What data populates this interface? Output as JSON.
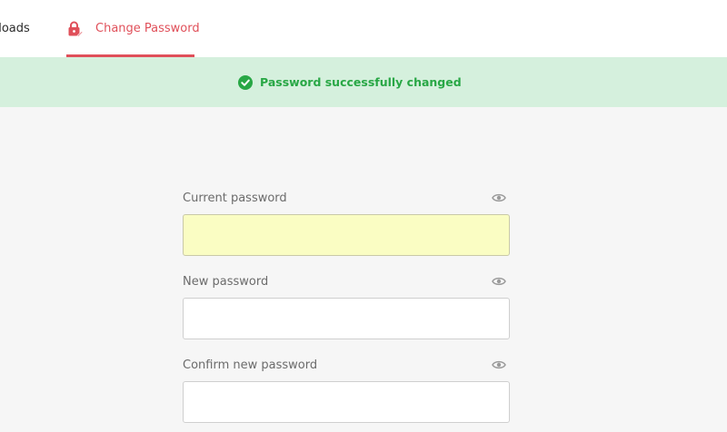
{
  "nav": {
    "tabs": [
      {
        "label": "nloads",
        "active": false
      },
      {
        "label": "Change Password",
        "active": true,
        "icon": "lock-edit-icon"
      }
    ]
  },
  "banner": {
    "icon": "check-circle-icon",
    "message": "Password successfully changed"
  },
  "form": {
    "fields": [
      {
        "label": "Current password",
        "value": "",
        "type": "password",
        "autofilled": true,
        "icon": "eye-icon"
      },
      {
        "label": "New password",
        "value": "",
        "type": "password",
        "autofilled": false,
        "icon": "eye-icon"
      },
      {
        "label": "Confirm new password",
        "value": "",
        "type": "password",
        "autofilled": false,
        "icon": "eye-icon"
      }
    ]
  },
  "colors": {
    "accent": "#e0505a",
    "success_text": "#28a745",
    "success_bg": "#d5f0dd",
    "autofill_bg": "#fafdc3"
  }
}
